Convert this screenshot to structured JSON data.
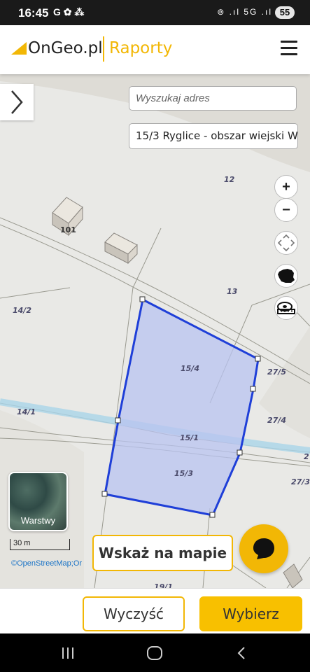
{
  "status": {
    "time": "16:45",
    "left_icons": "G ✿ ⁂",
    "right_icons": "⊚ .ıl 5G .ıl",
    "battery": "55"
  },
  "header": {
    "brand": "OnGeo.pl",
    "section": "Raporty"
  },
  "search": {
    "placeholder": "Wyszukaj adres"
  },
  "parcel": {
    "value": "15/3 Ryglice - obszar wiejski W"
  },
  "map_labels": {
    "p12": "12",
    "p101": "101",
    "p13": "13",
    "p14_2": "14/2",
    "p15_4": "15/4",
    "p27_5": "27/5",
    "p14_1": "14/1",
    "p27_4": "27/4",
    "p15_1": "15/1",
    "p2": "2",
    "p15_3": "15/3",
    "p27_3": "27/3",
    "p19_1": "19/1"
  },
  "controls": {
    "zoom_in": "+",
    "zoom_out": "−"
  },
  "layers": {
    "label": "Warstwy"
  },
  "scale": {
    "label": "30 m"
  },
  "attribution": "©OpenStreetMap;Or",
  "actions": {
    "point_on_map": "Wskaż na mapie",
    "clear": "Wyczyść",
    "select": "Wybierz"
  },
  "colors": {
    "accent": "#f2b705",
    "selection_fill": "#b8c3f0",
    "selection_stroke": "#1f3fd8"
  }
}
